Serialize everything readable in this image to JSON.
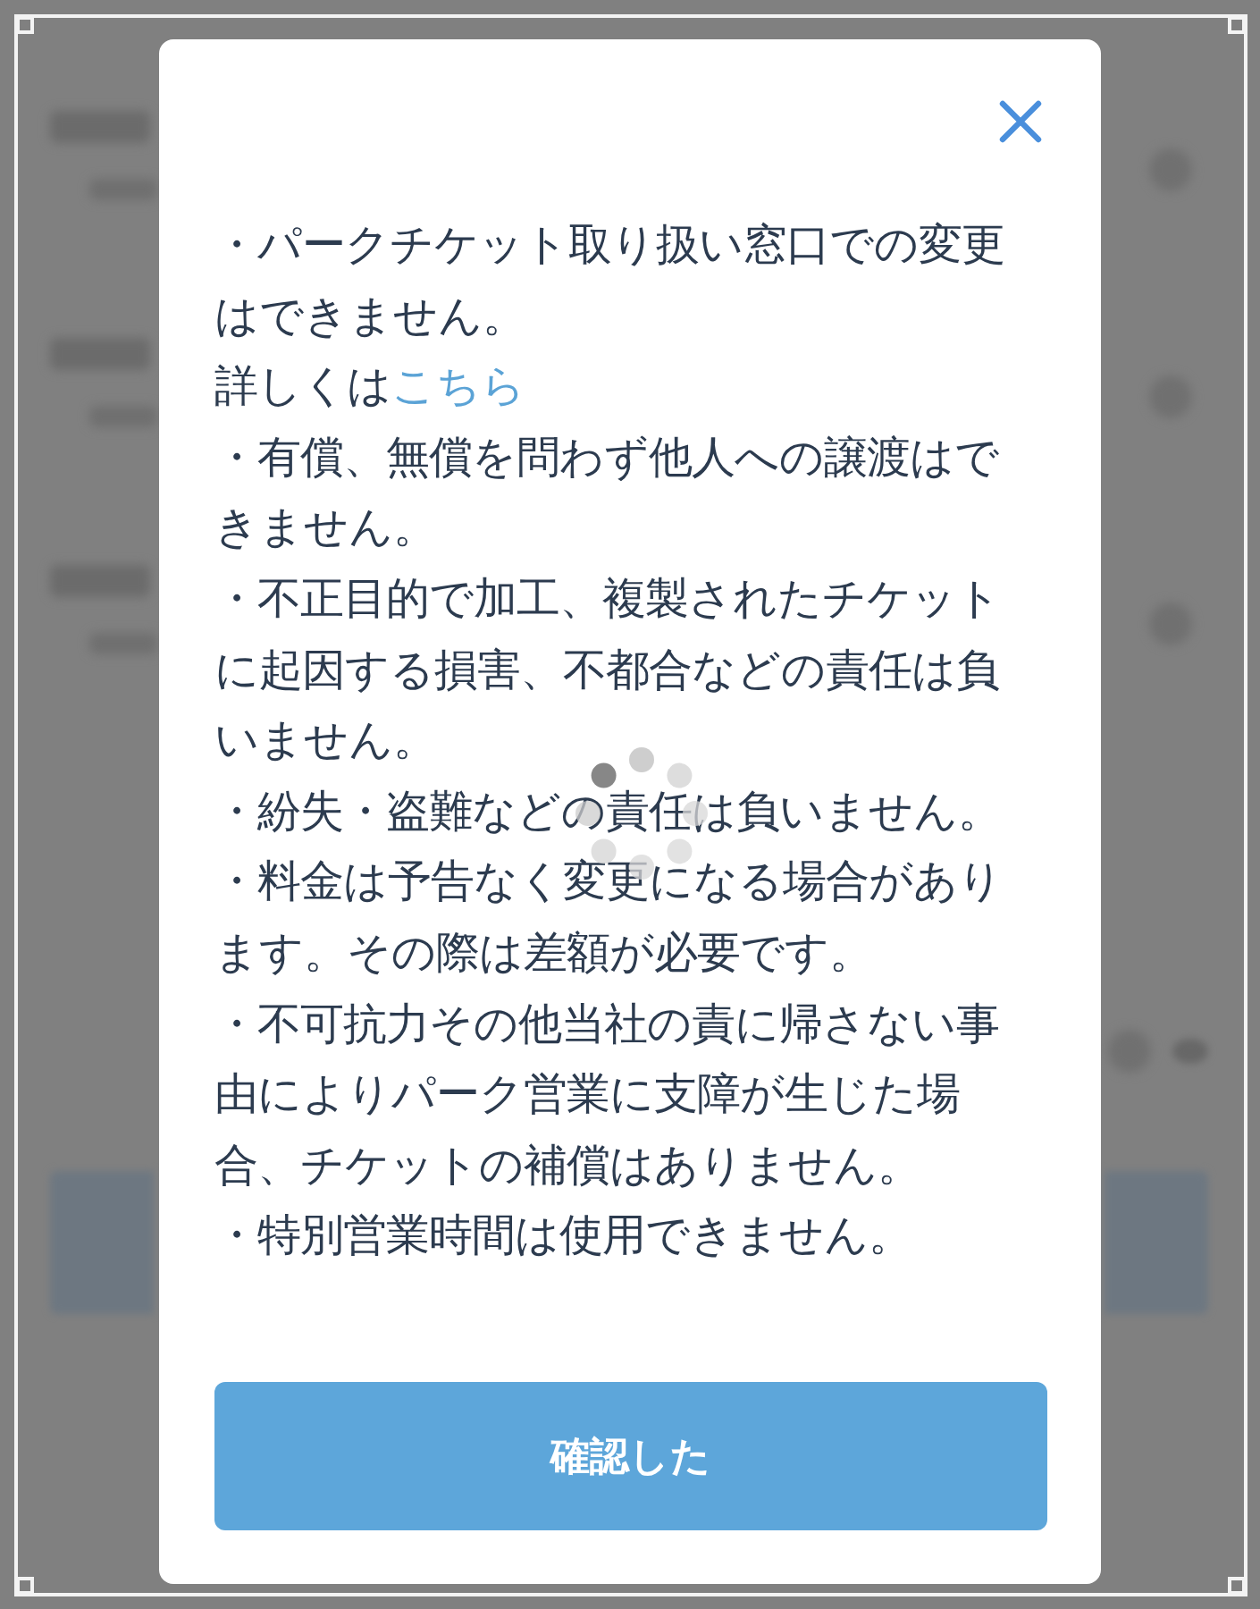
{
  "dialog": {
    "notices": [
      {
        "kind": "bullet",
        "text": "・パークチケット取り扱い窓口での変更はできません。"
      },
      {
        "kind": "link",
        "text": "詳しくは",
        "link": "こちら"
      },
      {
        "kind": "bullet",
        "text": "・有償、無償を問わず他人への譲渡はできません。"
      },
      {
        "kind": "bullet",
        "text": "・不正目的で加工、複製されたチケットに起因する損害、不都合などの責任は負いません。"
      },
      {
        "kind": "bullet",
        "text": "・紛失・盗難などの責任は負いません。"
      },
      {
        "kind": "bullet",
        "text": "・料金は予告なく変更になる場合があります。その際は差額が必要です。"
      },
      {
        "kind": "bullet",
        "text": "・不可抗力その他当社の責に帰さない事由によりパーク営業に支障が生じた場合、チケットの補償はありません。"
      },
      {
        "kind": "bullet",
        "text": "・特別営業時間は使用できません。"
      }
    ],
    "loading": true,
    "confirm_button": "確認した"
  }
}
